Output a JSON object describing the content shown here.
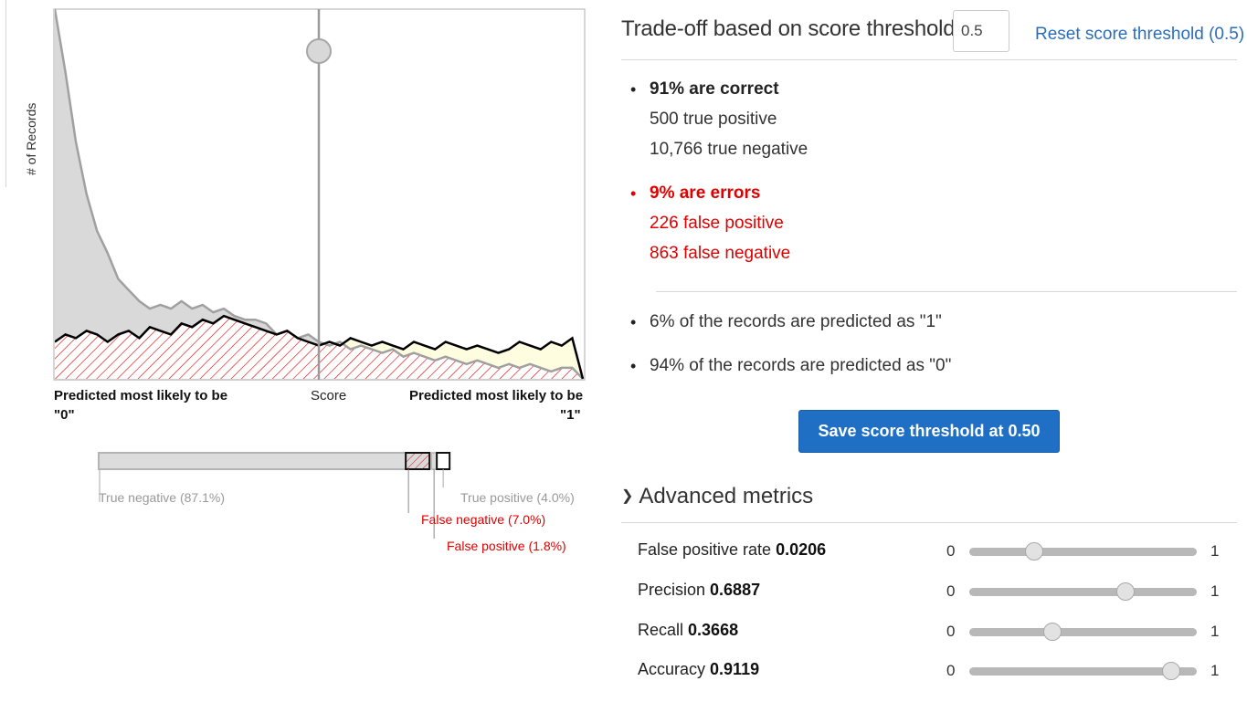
{
  "chart": {
    "y_label": "# of Records",
    "left_label": "Predicted most likely to be",
    "left_value": "\"0\"",
    "center_label": "Score",
    "right_label": "Predicted most likely to be",
    "right_value": "\"1\"",
    "threshold": 0.5
  },
  "chart_data": {
    "type": "area",
    "x_range": [
      0,
      1
    ],
    "threshold": 0.5,
    "series": [
      {
        "name": "\"0\"",
        "color": "#d9d9d9",
        "outline": "#a0a0a0",
        "x": [
          0,
          0.02,
          0.04,
          0.06,
          0.08,
          0.1,
          0.12,
          0.14,
          0.16,
          0.18,
          0.2,
          0.22,
          0.24,
          0.26,
          0.28,
          0.3,
          0.32,
          0.34,
          0.36,
          0.38,
          0.4,
          0.42,
          0.44,
          0.46,
          0.48,
          0.5,
          0.52,
          0.54,
          0.56,
          0.58,
          0.6,
          0.62,
          0.64,
          0.66,
          0.68,
          0.7,
          0.72,
          0.74,
          0.76,
          0.78,
          0.8,
          0.82,
          0.84,
          0.86,
          0.88,
          0.9,
          0.92,
          0.94,
          0.96,
          0.98,
          1.0
        ],
        "y": [
          1.0,
          0.83,
          0.64,
          0.5,
          0.4,
          0.34,
          0.27,
          0.24,
          0.21,
          0.19,
          0.2,
          0.19,
          0.21,
          0.19,
          0.2,
          0.18,
          0.19,
          0.17,
          0.16,
          0.16,
          0.15,
          0.12,
          0.13,
          0.11,
          0.12,
          0.1,
          0.09,
          0.1,
          0.08,
          0.09,
          0.08,
          0.07,
          0.08,
          0.06,
          0.07,
          0.06,
          0.05,
          0.06,
          0.05,
          0.04,
          0.05,
          0.04,
          0.03,
          0.04,
          0.03,
          0.04,
          0.03,
          0.02,
          0.03,
          0.03,
          0.0
        ]
      },
      {
        "name": "\"1\"",
        "color": "#fffde0",
        "outline": "#000000",
        "x": [
          0,
          0.02,
          0.04,
          0.06,
          0.08,
          0.1,
          0.12,
          0.14,
          0.16,
          0.18,
          0.2,
          0.22,
          0.24,
          0.26,
          0.28,
          0.3,
          0.32,
          0.34,
          0.36,
          0.38,
          0.4,
          0.42,
          0.44,
          0.46,
          0.48,
          0.5,
          0.52,
          0.54,
          0.56,
          0.58,
          0.6,
          0.62,
          0.64,
          0.66,
          0.68,
          0.7,
          0.72,
          0.74,
          0.76,
          0.78,
          0.8,
          0.82,
          0.84,
          0.86,
          0.88,
          0.9,
          0.92,
          0.94,
          0.96,
          0.98,
          1.0
        ],
        "y": [
          0.1,
          0.12,
          0.11,
          0.13,
          0.12,
          0.1,
          0.12,
          0.13,
          0.11,
          0.14,
          0.13,
          0.12,
          0.15,
          0.14,
          0.16,
          0.15,
          0.17,
          0.16,
          0.15,
          0.14,
          0.13,
          0.12,
          0.13,
          0.11,
          0.1,
          0.09,
          0.1,
          0.09,
          0.11,
          0.1,
          0.09,
          0.1,
          0.09,
          0.08,
          0.1,
          0.09,
          0.08,
          0.1,
          0.09,
          0.08,
          0.09,
          0.08,
          0.07,
          0.08,
          0.1,
          0.09,
          0.08,
          0.1,
          0.09,
          0.11,
          0.0
        ]
      }
    ]
  },
  "mix_bar": {
    "true_negative": "True negative (87.1%)",
    "false_negative": "False negative (7.0%)",
    "true_positive": "True positive (4.0%)",
    "false_positive": "False positive (1.8%)",
    "fractions": {
      "true_negative": 0.871,
      "false_negative": 0.07,
      "false_positive": 0.018,
      "true_positive": 0.04
    }
  },
  "tradeoff": {
    "title": "Trade-off based on score threshold",
    "threshold_value": "0.5",
    "reset_label": "Reset score threshold (0.5)",
    "correct_header": "91% are correct",
    "true_positive": "500 true positive",
    "true_negative": "10,766 true negative",
    "errors_header": "9% are errors",
    "false_positive": "226 false positive",
    "false_negative": "863 false negative",
    "predicted_1": "6% of the records are predicted as \"1\"",
    "predicted_0": "94% of the records are predicted as \"0\"",
    "save_label": "Save score threshold at 0.50"
  },
  "advanced": {
    "toggle_label": "Advanced metrics",
    "min_label": "0",
    "max_label": "1",
    "metrics": [
      {
        "label": "False positive rate",
        "value": "0.0206",
        "fraction": 0.0206
      },
      {
        "label": "Precision",
        "value": "0.6887",
        "fraction": 0.6887
      },
      {
        "label": "Recall",
        "value": "0.3668",
        "fraction": 0.3668
      },
      {
        "label": "Accuracy",
        "value": "0.9119",
        "fraction": 0.9119
      }
    ]
  },
  "colors": {
    "accent": "#1f6fc5",
    "error": "#e00000",
    "link": "#2a6ebb"
  }
}
